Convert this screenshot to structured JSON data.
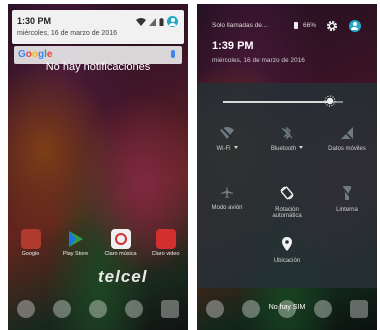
{
  "left_screen": {
    "time": "1:30 PM",
    "date": "miércoles, 16 de marzo de 2016",
    "google_logo": "Google",
    "empty_message": "No hay notificaciones",
    "apps": [
      {
        "label": "Google",
        "color": "#c0392b"
      },
      {
        "label": "Play Store",
        "color": "#2e7d32"
      },
      {
        "label": "Claro música",
        "color": "#e0e0e0"
      },
      {
        "label": "Claro video",
        "color": "#d32f2f"
      }
    ],
    "carrier_logo": "telcel"
  },
  "right_screen": {
    "status_text": "Solo llamadas de...",
    "battery": "66%",
    "time": "1:39 PM",
    "date": "miércoles, 16 de marzo de 2016",
    "brightness_level": 0.9,
    "tiles": {
      "wifi": "Wi-Fi",
      "bluetooth": "Bluetooth",
      "mobile_data": "Datos móviles",
      "airplane": "Modo avión",
      "rotation_line1": "Rotación",
      "rotation_line2": "automática",
      "flashlight": "Linterna",
      "location": "Ubicación"
    },
    "bottom_status": "No hay SIM"
  }
}
